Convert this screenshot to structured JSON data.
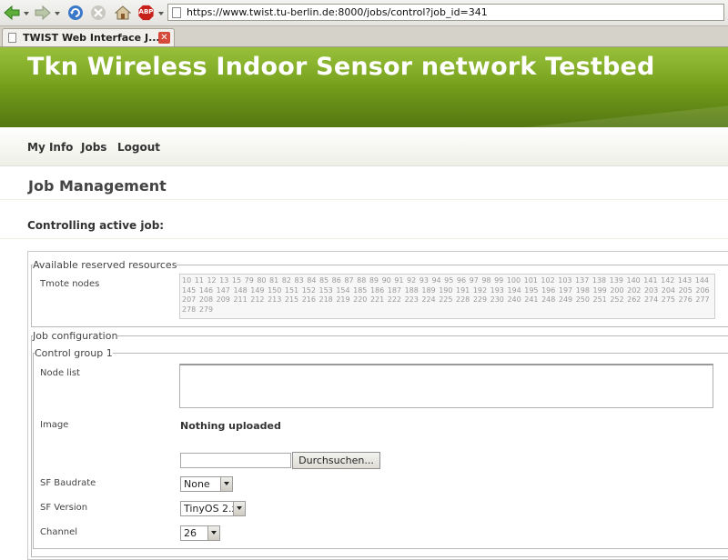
{
  "browser": {
    "url": "https://www.twist.tu-berlin.de:8000/jobs/control?job_id=341",
    "tab_title": "TWIST Web Interface J...",
    "tab_close": "✕",
    "back_icon": "arrow-left-icon",
    "forward_icon": "arrow-right-icon",
    "reload_icon": "reload-icon",
    "stop_icon": "stop-icon",
    "home_icon": "home-icon",
    "adblock_label": "ABP"
  },
  "header": {
    "title": "Tkn Wireless Indoor Sensor network Testbed"
  },
  "nav": {
    "my_info": "My Info",
    "jobs": "Jobs",
    "logout": "Logout"
  },
  "main": {
    "title": "Job Management",
    "subtitle": "Controlling active job:",
    "resources": {
      "legend": "Available reserved resources",
      "label": "Tmote nodes",
      "nodes": "10 11 12 13 15 79 80 81 82 83 84 85 86 87 88 89 90 91 92 93 94 95 96 97 98 99 100 101 102 103 137 138 139 140 141 142 143 144 145 146 147 148 149 150 151 152 153 154 185 186 187 188 189 190 191 192 193 194 195 196 197 198 199 200 202 203 204 205 206 207 208 209 211 212 213 215 216 218 219 220 221 222 223 224 225 228 229 230 240 241 248 249 250 251 252 262 274 275 276 277 278 279"
    },
    "job_config": {
      "legend": "Job configuration",
      "control_group": {
        "legend": "Control group 1",
        "node_list_label": "Node list",
        "image_label": "Image",
        "image_value": "Nothing uploaded",
        "browse_label": "Durchsuchen...",
        "sf_baudrate_label": "SF Baudrate",
        "sf_baudrate_value": "None",
        "sf_version_label": "SF Version",
        "sf_version_value": "TinyOS 2.x",
        "channel_label": "Channel",
        "channel_value": "26"
      }
    }
  }
}
